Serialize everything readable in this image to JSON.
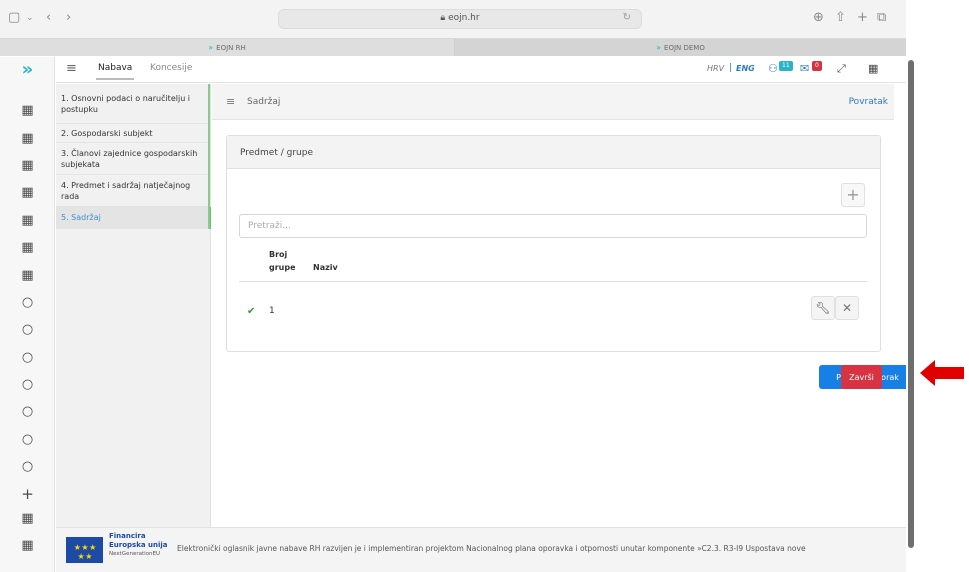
{
  "browser": {
    "address": "eojn.hr",
    "tabs": [
      "EOJN RH",
      "EOJN DEMO"
    ]
  },
  "header": {
    "nav_nabava": "Nabava",
    "nav_koncesije": "Koncesije",
    "lang_hrv": "HRV",
    "lang_sep": "|",
    "lang_eng": "ENG",
    "badge_1": "11",
    "badge_2": "0"
  },
  "steps": [
    "1. Osnovni podaci o naručitelju i postupku",
    "2. Gospodarski subjekt",
    "3. Članovi zajednice gospodarskih subjekata",
    "4. Predmet i sadržaj natječajnog rada",
    "5. Sadržaj"
  ],
  "content": {
    "title": "Sadržaj",
    "back_link": "Povratak",
    "card_title": "Predmet / grupe",
    "search_placeholder": "Pretraži...",
    "columns": [
      "Broj grupe",
      "Naziv"
    ],
    "rows": [
      {
        "broj": "1",
        "naziv": ""
      }
    ],
    "prev_button": "Prethodni korak",
    "finish_button": "Završi"
  },
  "footer": {
    "fin_1": "Financira",
    "fin_2": "Europska unija",
    "fin_3": "NextGenerationEU",
    "text": "Elektronički oglasnik javne nabave RH razvijen je i implementiran projektom Nacionalnog plana oporavka i otpornosti unutar komponente »C2.3. R3-I9 Uspostava nove"
  },
  "colors": {
    "accent_blue": "#1780e6",
    "finish_red": "#d83343",
    "annotation_arrow": "#e00000"
  }
}
